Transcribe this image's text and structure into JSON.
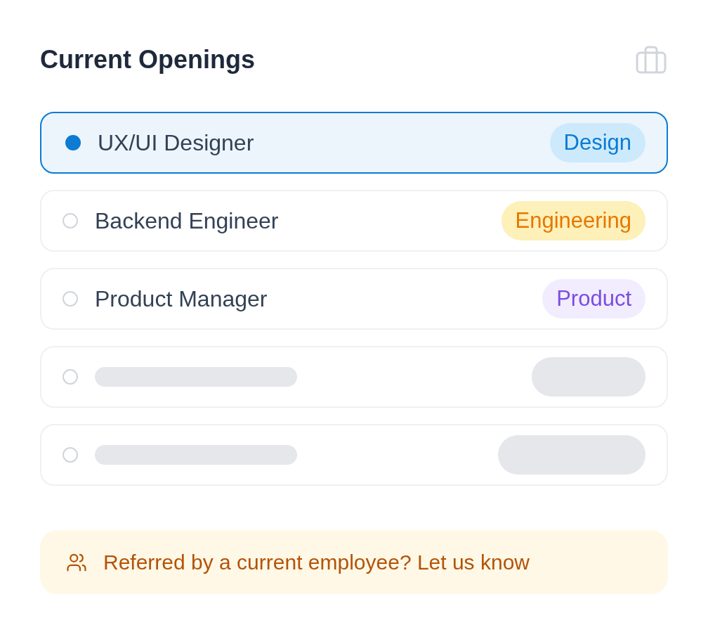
{
  "title": "Current Openings",
  "openings": [
    {
      "kind": "job",
      "title": "UX/UI Designer",
      "selected": true,
      "tag": {
        "label": "Design",
        "color": "#0b7bd4"
      }
    },
    {
      "kind": "job",
      "title": "Backend Engineer",
      "selected": false,
      "tag": {
        "label": "Engineering",
        "color": "#e67700"
      }
    },
    {
      "kind": "job",
      "title": "Product Manager",
      "selected": false,
      "tag": {
        "label": "Product",
        "color": "#7c4ce0"
      }
    },
    {
      "kind": "skeleton",
      "selected": false
    },
    {
      "kind": "skeleton",
      "selected": false
    }
  ],
  "referral": {
    "text": "Referred by a current employee? Let us know"
  }
}
